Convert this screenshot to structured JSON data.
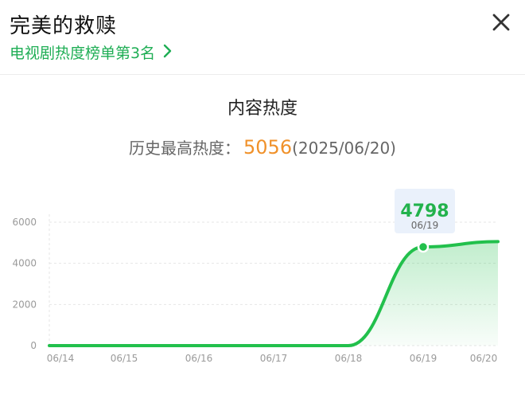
{
  "header": {
    "title": "完美的救赎",
    "rank_link": "电视剧热度榜单第3名",
    "close_icon": "close-icon"
  },
  "section": {
    "title": "内容热度",
    "peak_label": "历史最高热度：",
    "peak_value": "5056",
    "peak_date": "(2025/06/20)"
  },
  "colors": {
    "line": "#22c04c",
    "peak": "#f0912a",
    "link": "#1fae55"
  },
  "chart_data": {
    "type": "area",
    "x": [
      "06/14",
      "06/15",
      "06/16",
      "06/17",
      "06/18",
      "06/19",
      "06/20"
    ],
    "y_points": [
      {
        "x": "06/14",
        "y": 0
      },
      {
        "x": "06/15",
        "y": 0
      },
      {
        "x": "06/16",
        "y": 0
      },
      {
        "x": "06/17",
        "y": 0
      },
      {
        "x": "06/18",
        "y": 0
      },
      {
        "x": "06/19",
        "y": 4798
      },
      {
        "x": "06/20",
        "y": 5056
      }
    ],
    "yticks": [
      "0",
      "2000",
      "4000",
      "6000"
    ],
    "ylim": [
      0,
      6000
    ],
    "grid": true,
    "tooltip": {
      "value": "4798",
      "date": "06/19"
    }
  }
}
